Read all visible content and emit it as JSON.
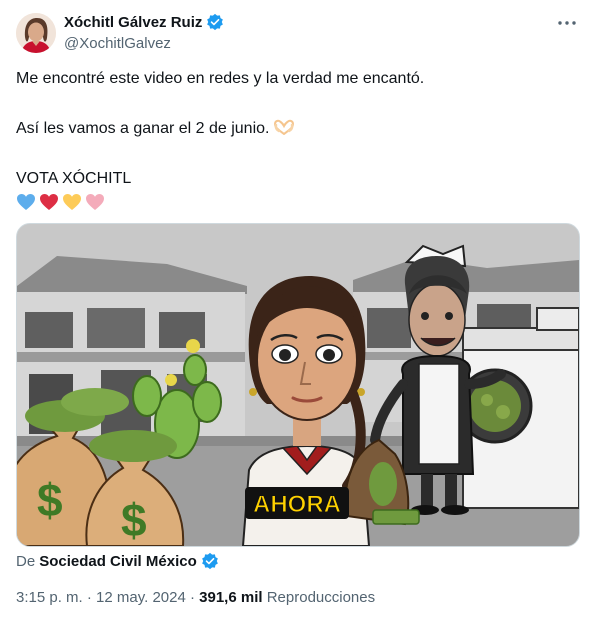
{
  "author": {
    "name": "Xóchitl Gálvez Ruiz",
    "handle": "@XochitlGalvez"
  },
  "tweet": {
    "line1": "Me encontré este video en redes y la verdad me encantó.",
    "line2": "Así les vamos a ganar el 2 de junio.",
    "line3": "VOTA XÓCHITL",
    "hand_emoji": "heart-hands-icon",
    "hearts": [
      "blue-heart-icon",
      "red-heart-icon",
      "yellow-heart-icon",
      "pink-heart-icon"
    ]
  },
  "media": {
    "caption_text": "AHORA"
  },
  "source": {
    "prefix": "De",
    "name": "Sociedad Civil México"
  },
  "meta": {
    "timestamp": "3:15 p. m. · 12 may. 2024 ·",
    "views_count": "391,6 mil",
    "views_label": "Reproducciones"
  },
  "colors": {
    "verified_blue": "#1d9bf0",
    "secondary_text": "#536471",
    "caption_yellow": "#ffd200"
  }
}
